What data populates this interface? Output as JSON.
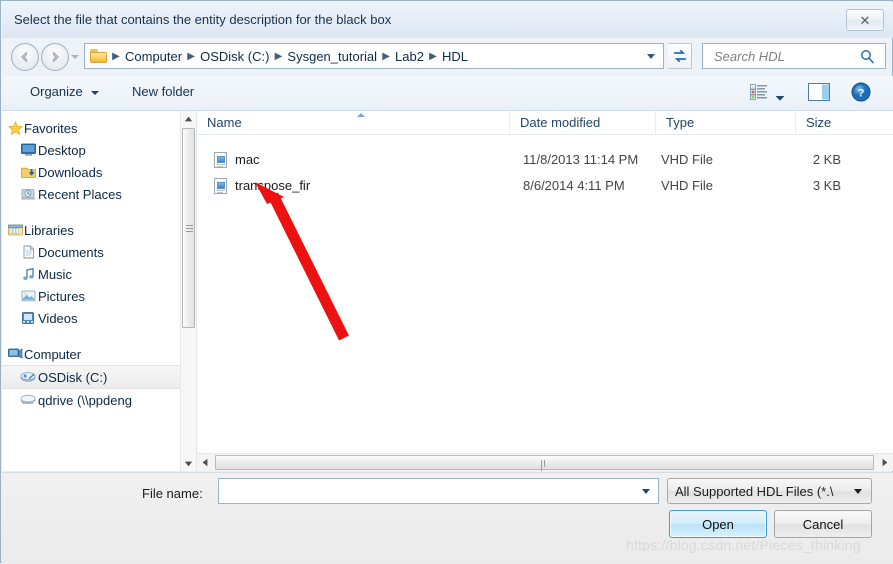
{
  "dialog": {
    "title": "Select the file that contains the entity description for the black box",
    "close_label": "✕"
  },
  "addressbar": {
    "back_icon": "back-arrow-icon",
    "forward_icon": "forward-arrow-icon",
    "history_icon": "chevron-down-icon",
    "folder_icon": "folder-icon",
    "crumbs": [
      "Computer",
      "OSDisk (C:)",
      "Sysgen_tutorial",
      "Lab2",
      "HDL"
    ],
    "separator": "▶",
    "dropdown_icon": "chevron-down-icon",
    "refresh_icon": "refresh-icon",
    "search_placeholder": "Search HDL",
    "search_value": "",
    "search_icon": "search-icon"
  },
  "toolbar": {
    "organize_label": "Organize",
    "organize_caret": "chevron-down-icon",
    "new_folder_label": "New folder",
    "view_icon": "view-list-icon",
    "view_caret": "chevron-down-icon",
    "preview_pane_icon": "preview-pane-icon",
    "help_icon": "help-icon"
  },
  "navpane": {
    "items": [
      {
        "label": "Favorites",
        "icon": "star-icon",
        "level": "root",
        "selected": false
      },
      {
        "label": "Desktop",
        "icon": "desktop-icon",
        "level": "child",
        "selected": false
      },
      {
        "label": "Downloads",
        "icon": "downloads-icon",
        "level": "child",
        "selected": false
      },
      {
        "label": "Recent Places",
        "icon": "recent-places-icon",
        "level": "child",
        "selected": false
      },
      {
        "label": "Libraries",
        "icon": "libraries-icon",
        "level": "root",
        "selected": false
      },
      {
        "label": "Documents",
        "icon": "documents-icon",
        "level": "child",
        "selected": false
      },
      {
        "label": "Music",
        "icon": "music-icon",
        "level": "child",
        "selected": false
      },
      {
        "label": "Pictures",
        "icon": "pictures-icon",
        "level": "child",
        "selected": false
      },
      {
        "label": "Videos",
        "icon": "videos-icon",
        "level": "child",
        "selected": false
      },
      {
        "label": "Computer",
        "icon": "computer-icon",
        "level": "root",
        "selected": false
      },
      {
        "label": "OSDisk (C:)",
        "icon": "harddisk-icon",
        "level": "child",
        "selected": true
      },
      {
        "label": "qdrive (\\\\ppdeng",
        "icon": "network-drive-icon",
        "level": "child",
        "selected": false
      }
    ],
    "scroll_up_icon": "scroll-up-icon",
    "scroll_down_icon": "scroll-down-icon"
  },
  "filelist": {
    "columns": [
      {
        "label": "Name",
        "sorted": true
      },
      {
        "label": "Date modified",
        "sorted": false
      },
      {
        "label": "Type",
        "sorted": false
      },
      {
        "label": "Size",
        "sorted": false
      }
    ],
    "sort_indicator": "sort-ascending-icon",
    "rows": [
      {
        "name": "mac",
        "date": "11/8/2013 11:14 PM",
        "type": "VHD File",
        "size": "2 KB",
        "icon": "vhd-file-icon"
      },
      {
        "name": "transpose_fir",
        "date": "8/6/2014 4:11 PM",
        "type": "VHD File",
        "size": "3 KB",
        "icon": "vhd-file-icon"
      }
    ],
    "hscroll_left_icon": "scroll-left-icon",
    "hscroll_right_icon": "scroll-right-icon"
  },
  "bottom": {
    "filename_label": "File name:",
    "filename_value": "",
    "filename_placeholder": "",
    "filename_caret": "chevron-down-icon",
    "filter_label": "All Supported HDL Files  (*.\\",
    "filter_caret": "chevron-down-icon",
    "open_label": "Open",
    "cancel_label": "Cancel"
  },
  "annotation": {
    "arrow_color": "#ee1111",
    "arrow_name": "red-pointer-arrow"
  },
  "watermark": {
    "text": "https://blog.csdn.net/Pieces_thinking"
  },
  "colors": {
    "accent": "#3c9ad6",
    "title_text": "#16334d",
    "dialog_bg": "#eef3f9"
  }
}
